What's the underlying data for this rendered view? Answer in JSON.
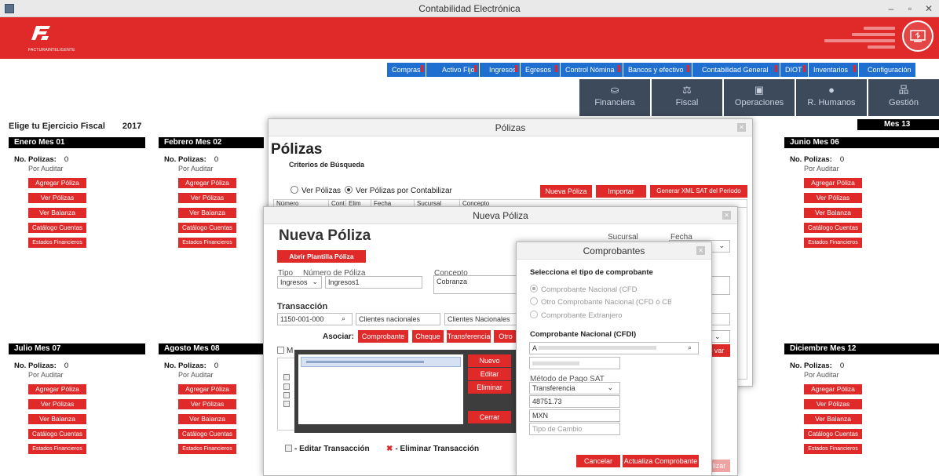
{
  "window": {
    "title": "Contabilidad Electrónica",
    "controls": [
      "–",
      "▫",
      "✕"
    ]
  },
  "logo": {
    "text": "FACTURAINTELIGENTE"
  },
  "menu": [
    {
      "label": "Compras"
    },
    {
      "label": "Activo Fijo"
    },
    {
      "label": "Ingresos"
    },
    {
      "label": "Egresos"
    },
    {
      "label": "Control Nómina"
    },
    {
      "label": "Bancos y efectivo"
    },
    {
      "label": "Contabilidad General"
    },
    {
      "label": "DIOT"
    },
    {
      "label": "Inventarios"
    },
    {
      "label": "Configuración"
    }
  ],
  "modules": [
    {
      "label": "Financiera",
      "icon": "coins-icon"
    },
    {
      "label": "Fiscal",
      "icon": "scale-icon"
    },
    {
      "label": "Operaciones",
      "icon": "clipboard-icon"
    },
    {
      "label": "R. Humanos",
      "icon": "user-icon"
    },
    {
      "label": "Gestión",
      "icon": "org-chart-icon"
    }
  ],
  "fiscal_year": {
    "label": "Elige tu Ejercicio Fiscal",
    "value": "2017"
  },
  "month13": "Mes 13",
  "month_common": {
    "count_label": "No. Polizas:",
    "count": "0",
    "status": "Por Auditar",
    "buttons": [
      "Agregar Póliza",
      "Ver Pólizas",
      "Ver Balanza",
      "Catálogo Cuentas",
      "Estados Financieros"
    ]
  },
  "months": [
    {
      "title": "Enero Mes 01"
    },
    {
      "title": "Febrero Mes 02"
    },
    {
      "title": "Junio Mes 06"
    },
    {
      "title": "Julio Mes 07"
    },
    {
      "title": "Agosto Mes 08"
    },
    {
      "title": "Diciembre Mes 12"
    }
  ],
  "polizas": {
    "window_title": "Pólizas",
    "heading": "Pólizas",
    "criteria": "Criterios de Búsqueda",
    "radio_all": "Ver Pólizas",
    "radio_pending": "Ver Pólizas por Contabilizar",
    "btn_new": "Nueva Póliza",
    "btn_import": "Importar",
    "btn_xml": "Generar XML SAT del Periodo",
    "columns": [
      "Número",
      "Cont",
      "Elim",
      "Fecha",
      "Sucursal",
      "Concepto"
    ]
  },
  "nueva": {
    "window_title": "Nueva Póliza",
    "heading": "Nueva Póliza",
    "btn_template": "Abrir Plantilla Póliza",
    "lbl_sucursal": "Sucursal",
    "lbl_fecha": "Fecha",
    "lbl_tipo": "Tipo",
    "tipo_value": "Ingresos",
    "lbl_numero": "Número de Póliza",
    "numero_value": "Ingresos1",
    "lbl_concepto": "Concepto",
    "concepto_value": "Cobranza",
    "transaccion": "Transacción",
    "cuenta_value": "1150-001-000",
    "cuenta_nombre": "Clientes nacionales",
    "cuenta_grupo": "Clientes Nacionales",
    "asociar": "Asociar:",
    "assoc_buttons": [
      "Comprobante",
      "Cheque",
      "Transferencia",
      "Otro"
    ],
    "check_m": "M",
    "popup_buttons": [
      "Nuevo",
      "Editar",
      "Eliminar",
      "Cerrar"
    ],
    "legend_edit": "- Editar Transacción",
    "legend_delete": "- Eliminar Transacción",
    "btn_save_partial": "lizar",
    "btn_right_partial": "var"
  },
  "comprobantes": {
    "window_title": "Comprobantes",
    "prompt": "Selecciona el tipo de comprobante",
    "options": [
      "Comprobante Nacional (CFD",
      "Otro Comprobante Nacional (CFD ó CBI",
      "Comprobante Extranjero"
    ],
    "section": "Comprobante Nacional (CFDI)",
    "uuid_prefix": "A",
    "lbl_metodo": "Método de Pago SAT",
    "metodo_value": "Transferencia",
    "monto": "48751.73",
    "moneda": "MXN",
    "tipo_cambio_placeholder": "Tipo de Cambio",
    "btn_cancel": "Cancelar",
    "btn_update": "Actualiza Comprobante"
  }
}
